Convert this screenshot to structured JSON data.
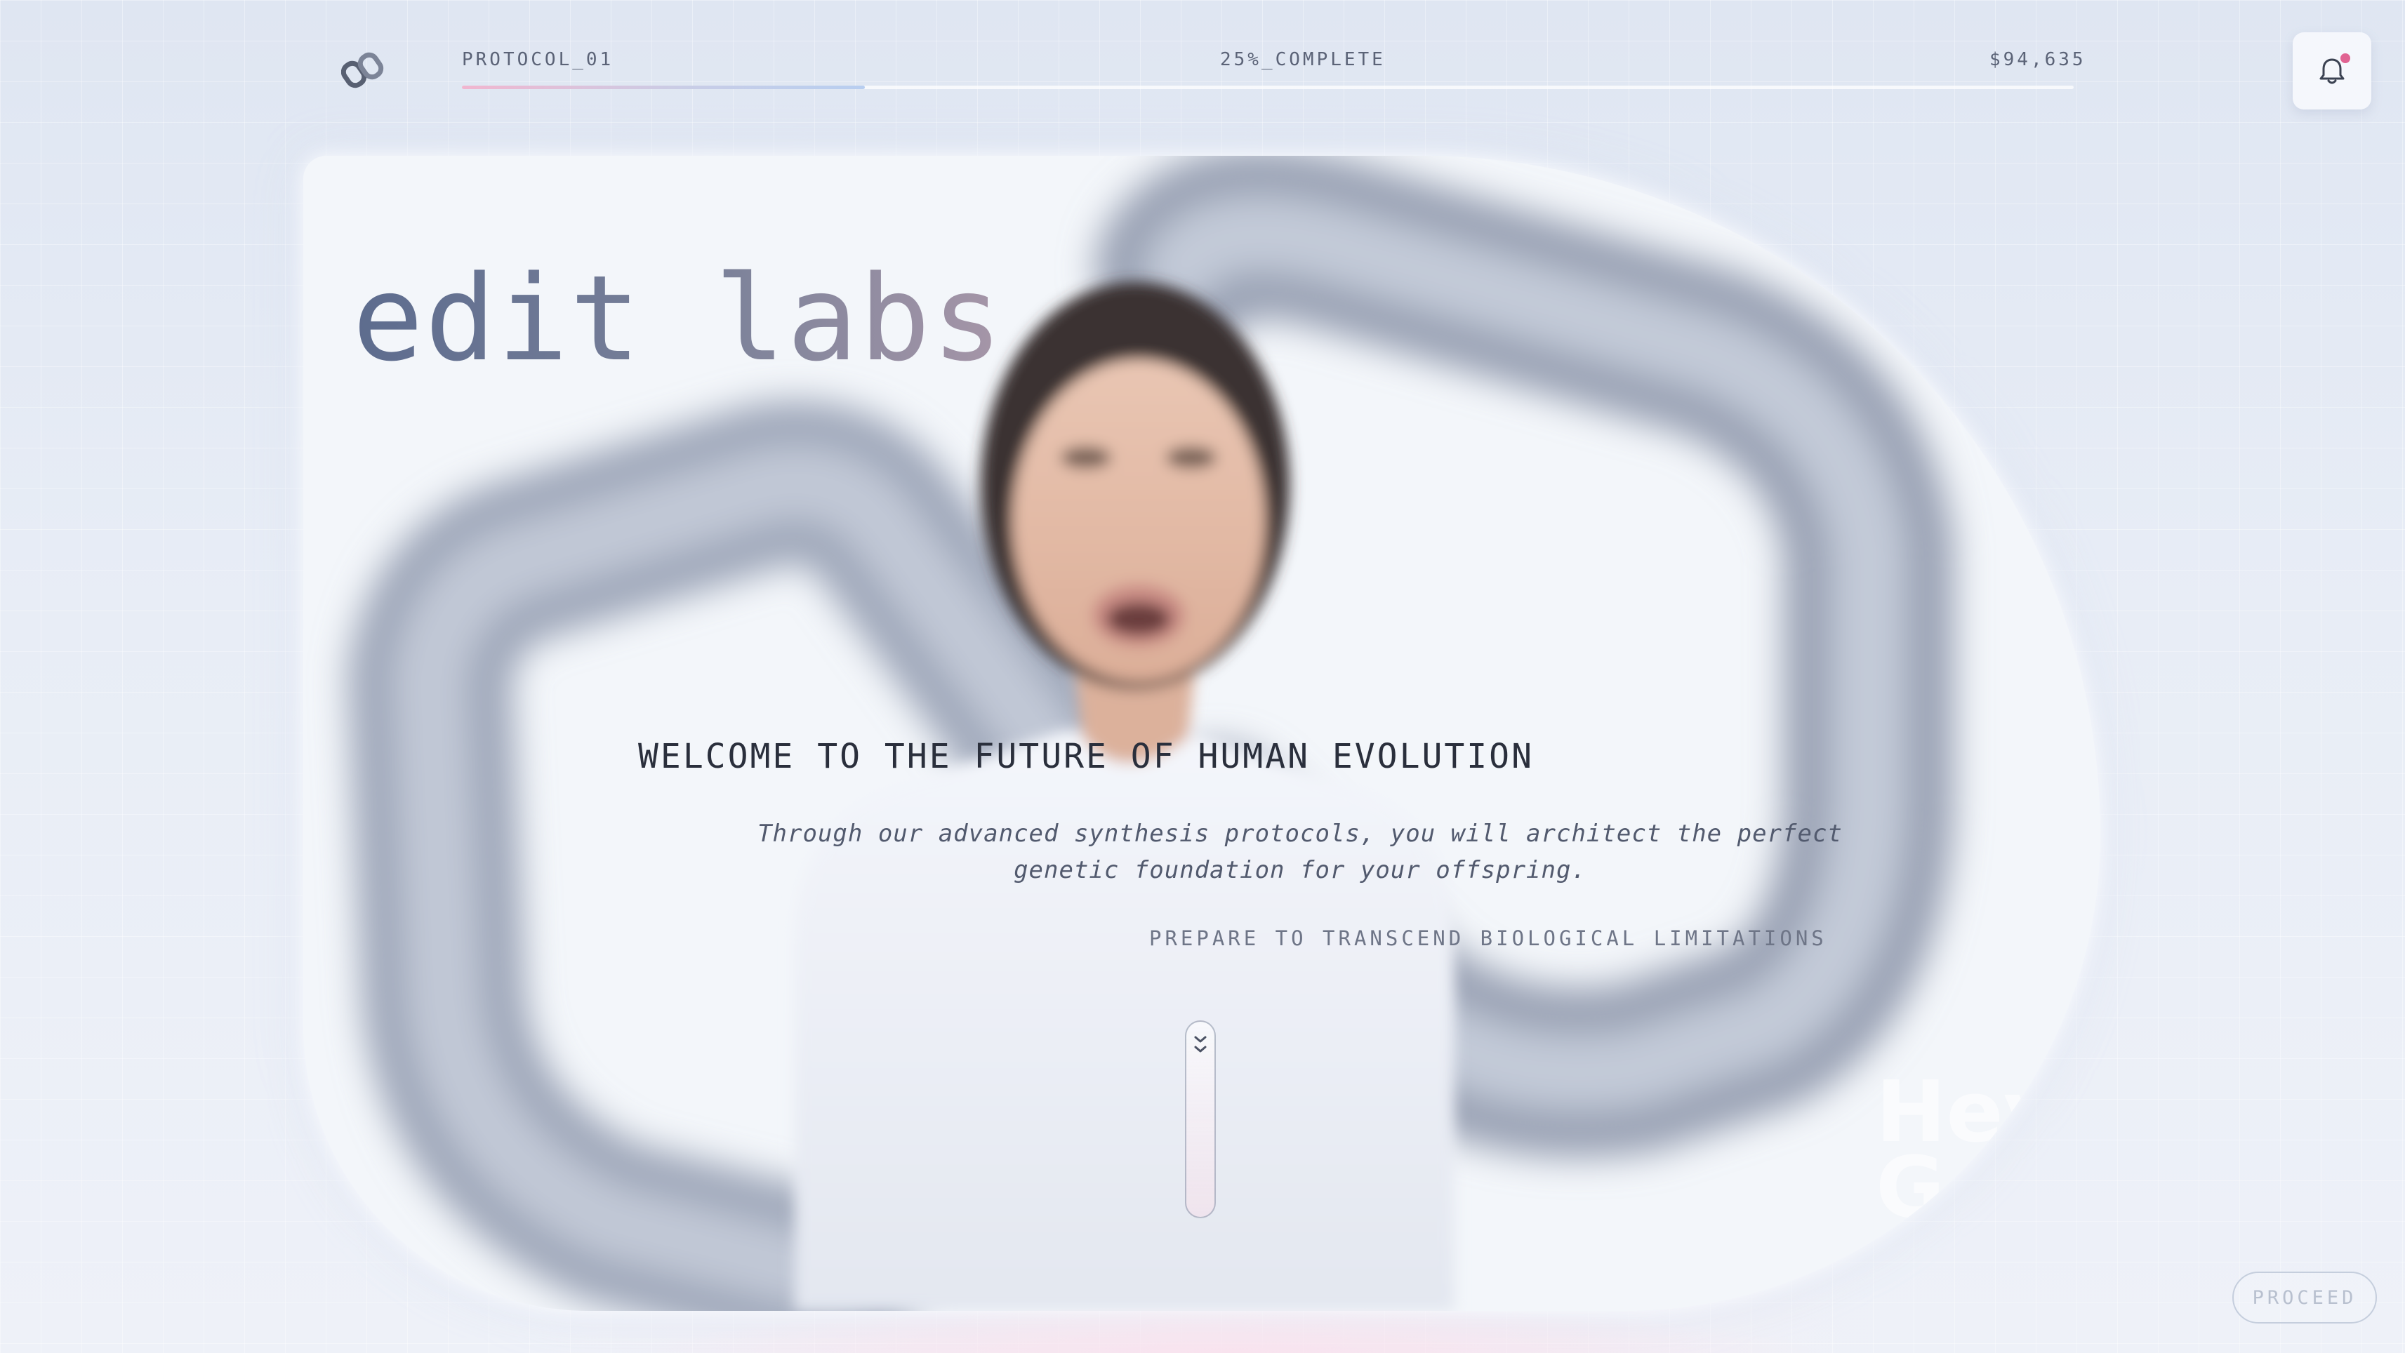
{
  "header": {
    "protocol_label": "PROTOCOL_01",
    "progress_label": "25%_COMPLETE",
    "progress_fraction": 0.25,
    "balance": "$94,635",
    "notification_unread": true
  },
  "hero": {
    "brand": "edit labs",
    "headline": "WELCOME TO THE FUTURE OF HUMAN EVOLUTION",
    "subcopy_line1": "Through our advanced synthesis protocols, you will architect the perfect",
    "subcopy_line2": "genetic foundation for your offspring.",
    "tagline": "PREPARE TO TRANSCEND BIOLOGICAL LIMITATIONS",
    "watermark_line1": "Hey",
    "watermark_line2": "G"
  },
  "footer": {
    "proceed_label": "PROCEED"
  },
  "icons": {
    "logo": "chain-link-logo-icon",
    "notification": "bell-icon",
    "scroll": "chevron-double-down-icon"
  },
  "colors": {
    "accent_pink": "#e06392",
    "progress_start": "#f1b6cf",
    "progress_end": "#b8cef0",
    "text_dark": "#2a2f3c",
    "text_muted": "#6e7587"
  }
}
